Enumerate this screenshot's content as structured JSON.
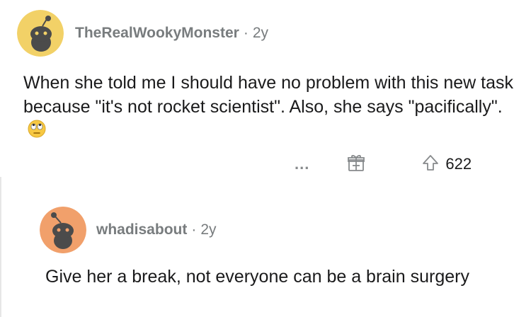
{
  "comment": {
    "author": "TheRealWookyMonster",
    "separator": "·",
    "age": "2y",
    "body": "When she told me I should have no problem with this new task because \"it's not rocket scientist\". Also, she says \"pacifically\".",
    "emoji": "eye-roll-emoji",
    "actions": {
      "more_label": "...",
      "score": "622"
    }
  },
  "reply": {
    "author": "whadisabout",
    "separator": "·",
    "age": "2y",
    "body": "Give her a break, not everyone can be a brain surgery"
  },
  "colors": {
    "avatar_1": "#f2d167",
    "avatar_2": "#f1a06b",
    "muted": "#787c7e",
    "text": "#1a1a1b"
  }
}
